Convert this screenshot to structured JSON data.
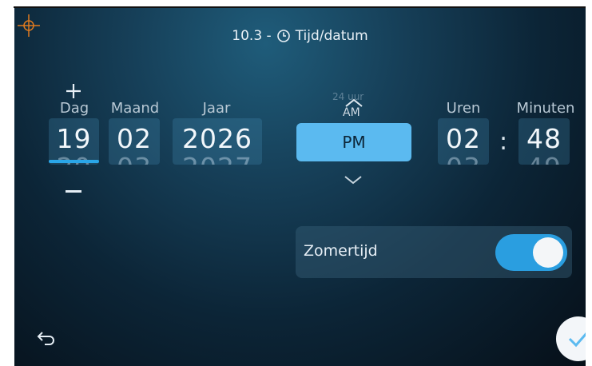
{
  "header": {
    "title": "10.3 - ⏲ Tijd/datum",
    "title_text": "Tijd/datum",
    "title_prefix": "10.3 -"
  },
  "date": {
    "day": {
      "label": "Dag",
      "value": "19",
      "next": "20"
    },
    "month": {
      "label": "Maand",
      "value": "02",
      "next": "03"
    },
    "year": {
      "label": "Jaar",
      "value": "2026",
      "next": "2027"
    }
  },
  "ampm": {
    "mode_hint": "24 uur",
    "above": "AM",
    "selected": "PM"
  },
  "time": {
    "hours": {
      "label": "Uren",
      "value": "02",
      "next": "03"
    },
    "minutes": {
      "label": "Minuten",
      "value": "48",
      "next": "49"
    },
    "separator": ":"
  },
  "dst": {
    "label": "Zomertijd",
    "enabled": true
  },
  "colors": {
    "accent": "#2aa6e8",
    "selected_bg": "#5bbaf0",
    "crosshair": "#e07a1f"
  },
  "icons": [
    "crosshair-icon",
    "clock-icon",
    "plus-icon",
    "minus-icon",
    "chevron-up-icon",
    "chevron-down-icon",
    "back-arrow-icon",
    "checkmark-icon"
  ]
}
